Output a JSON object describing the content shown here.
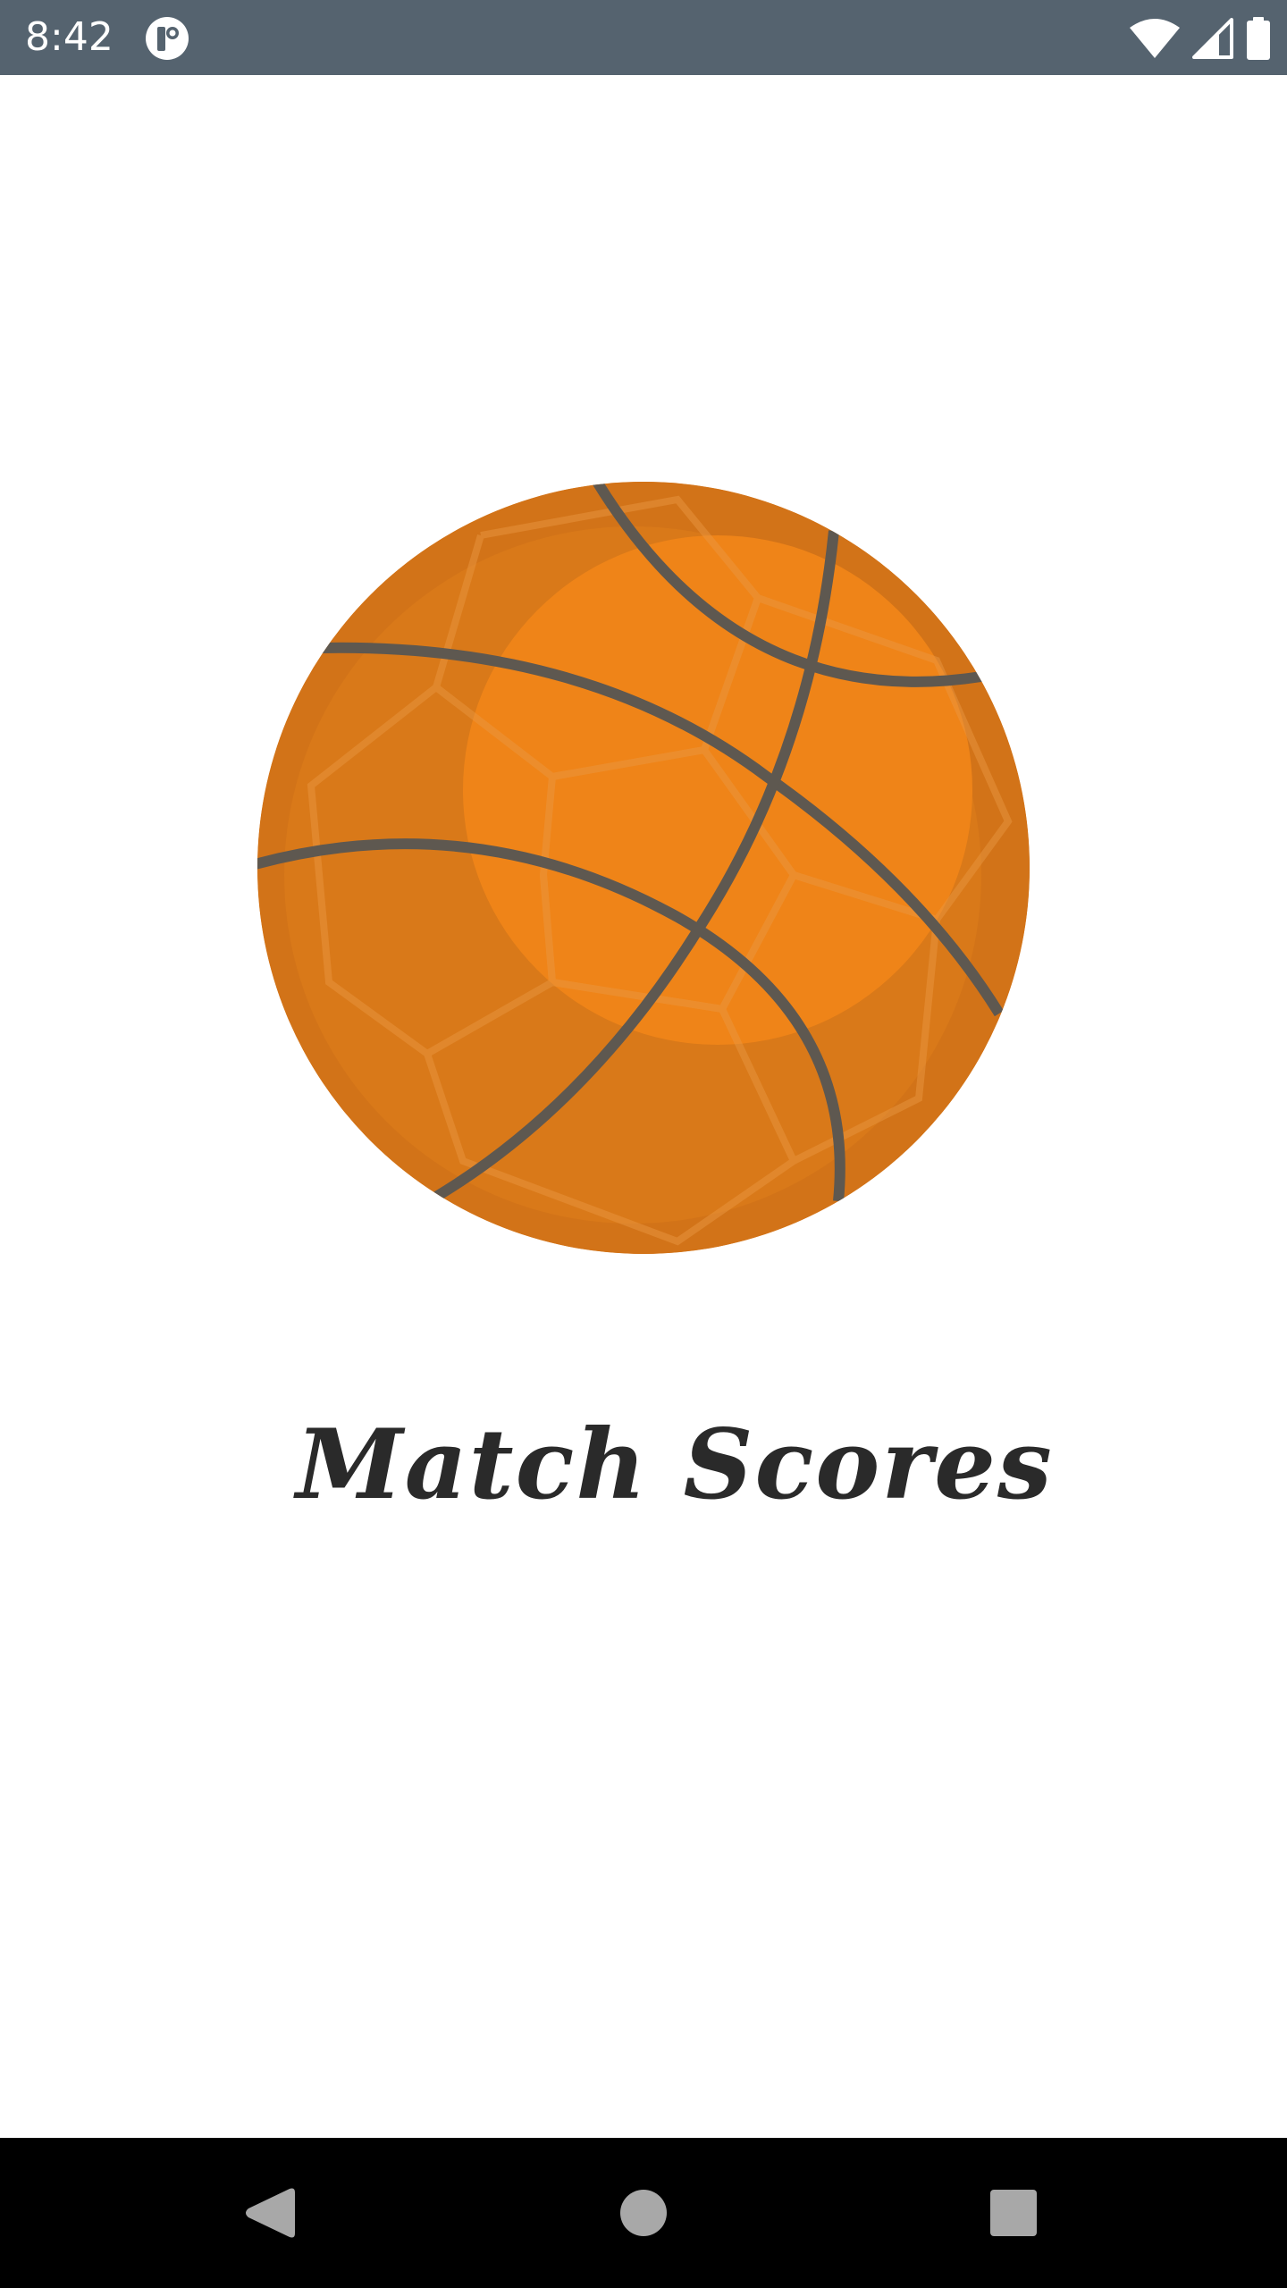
{
  "status_bar": {
    "time": "8:42",
    "icons": [
      "app-notification-icon",
      "wifi-icon",
      "cell-signal-icon",
      "battery-icon"
    ]
  },
  "splash": {
    "logo": "basketball-icon",
    "title": "Match Scores"
  },
  "nav_bar": {
    "buttons": [
      "back-button",
      "home-button",
      "recents-button"
    ]
  },
  "colors": {
    "status_bar_bg": "#55636f",
    "ball_orange": "#ef8418",
    "ball_dark_orange": "#d97818",
    "ball_lines": "#5e5850",
    "title_text": "#2a2a2a",
    "nav_bar_bg": "#000000",
    "nav_icons": "#a8a8a8"
  }
}
